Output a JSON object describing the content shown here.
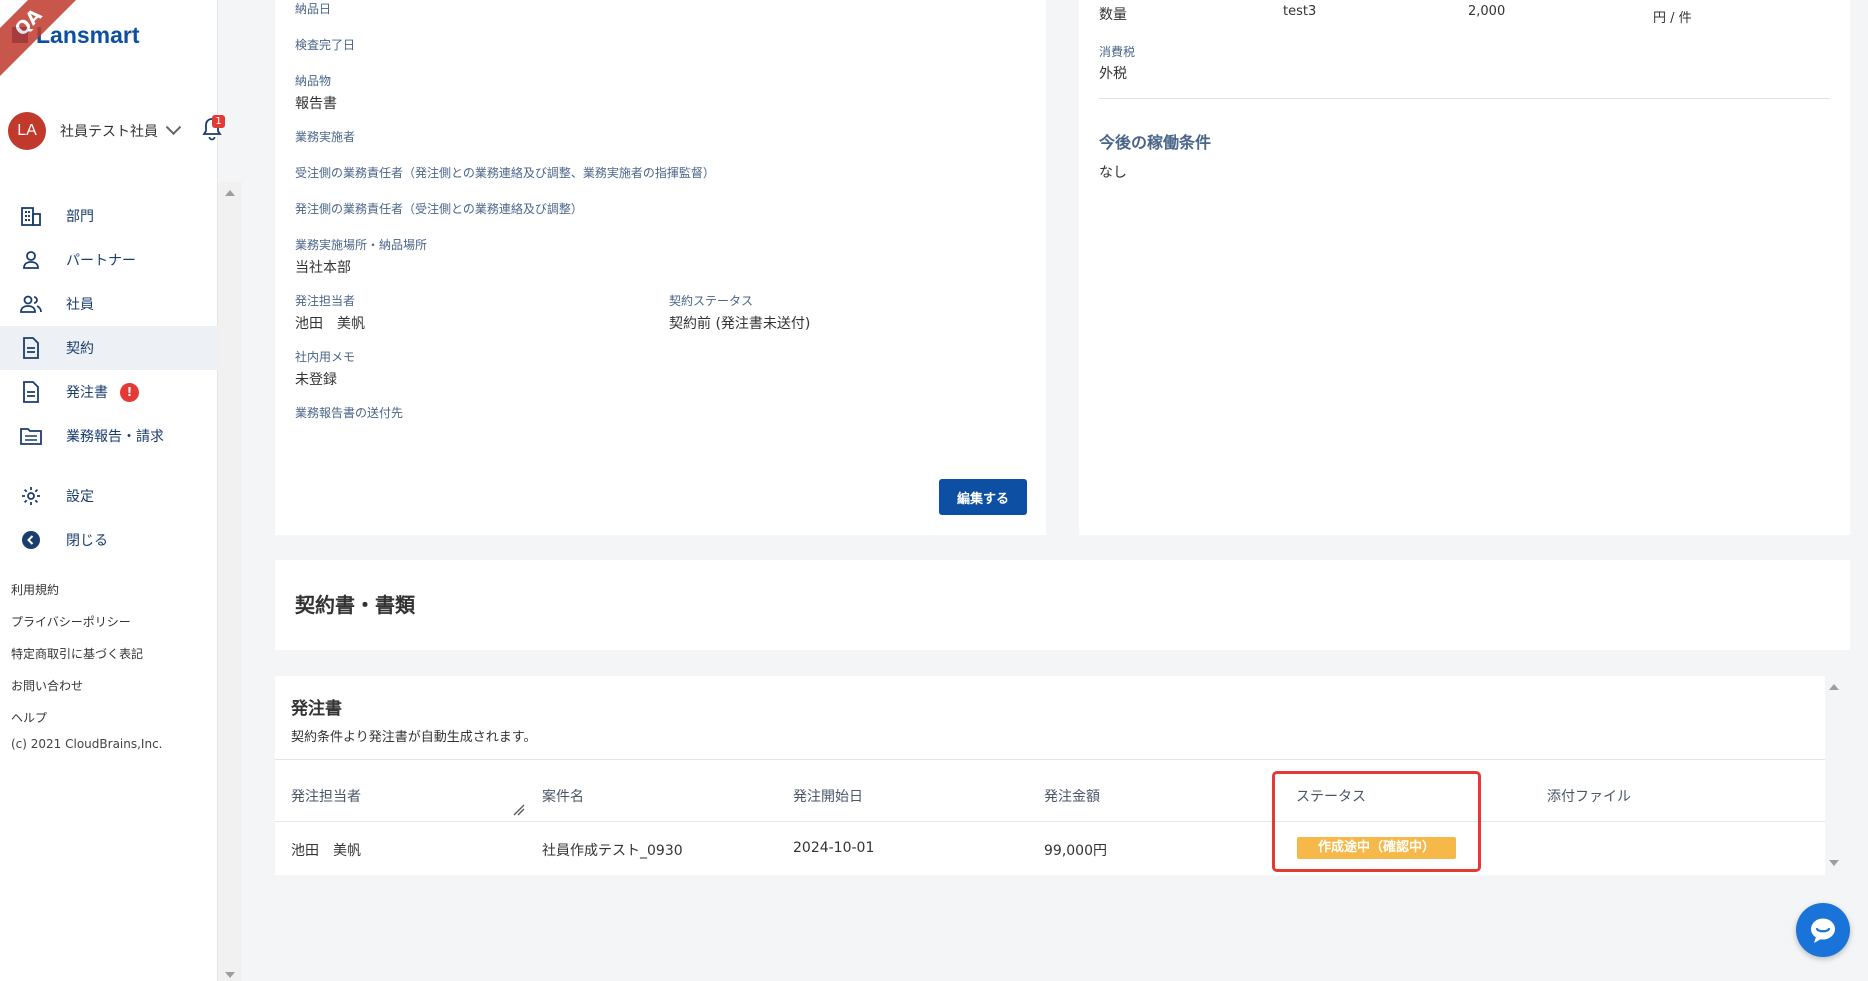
{
  "ribbon": "QA",
  "brand": {
    "name": "Lansmart"
  },
  "user": {
    "initials": "LA",
    "name": "社員テスト社員",
    "notification_count": "1"
  },
  "menu": {
    "items": [
      {
        "label": "部門",
        "icon": "building-icon"
      },
      {
        "label": "パートナー",
        "icon": "person-icon"
      },
      {
        "label": "社員",
        "icon": "people-icon"
      },
      {
        "label": "契約",
        "icon": "document-icon",
        "active": true
      },
      {
        "label": "発注書",
        "icon": "document-icon",
        "badge": "!"
      },
      {
        "label": "業務報告・請求",
        "icon": "folder-icon"
      }
    ],
    "settings_label": "設定",
    "close_label": "閉じる"
  },
  "footer": {
    "links": [
      "利用規約",
      "プライバシーポリシー",
      "特定商取引に基づく表記",
      "お問い合わせ",
      "ヘルプ"
    ],
    "copyright": "(c) 2021 CloudBrains,Inc."
  },
  "contract": {
    "delivery_date_label": "納品日",
    "inspection_date_label": "検査完了日",
    "deliverable_label": "納品物",
    "deliverable_value": "報告書",
    "executor_label": "業務実施者",
    "receiver_manager_label": "受注側の業務責任者（発注側との業務連絡及び調整、業務実施者の指揮監督）",
    "orderer_manager_label": "発注側の業務責任者（受注側との業務連絡及び調整）",
    "location_label": "業務実施場所・納品場所",
    "location_value": "当社本部",
    "order_person_label": "発注担当者",
    "order_person_value": "池田　美帆",
    "status_label": "契約ステータス",
    "status_value": "契約前 (発注書未送付)",
    "memo_label": "社内用メモ",
    "memo_value": "未登録",
    "report_dest_label": "業務報告書の送付先",
    "edit_button": "編集する"
  },
  "pricing": {
    "quantity_label": "数量",
    "item_name": "test3",
    "amount": "2,000",
    "unit": "円 / 件",
    "tax_label": "消費税",
    "tax_value": "外税",
    "future_title": "今後の稼働条件",
    "future_value": "なし"
  },
  "documents": {
    "title": "契約書・書類"
  },
  "purchase_orders": {
    "title": "発注書",
    "subtitle": "契約条件より発注書が自動生成されます。",
    "columns": [
      "発注担当者",
      "案件名",
      "発注開始日",
      "発注金額",
      "ステータス",
      "添付ファイル"
    ],
    "rows": [
      {
        "person": "池田　美帆",
        "project": "社員作成テスト_0930",
        "start_date": "2024-10-01",
        "amount": "99,000円",
        "status": "作成途中（確認中）",
        "attachment": ""
      }
    ]
  },
  "colors": {
    "brand": "#0d4fa3",
    "status_badge": "#f6b849",
    "highlight": "#e53935",
    "chat": "#1a73d8"
  }
}
